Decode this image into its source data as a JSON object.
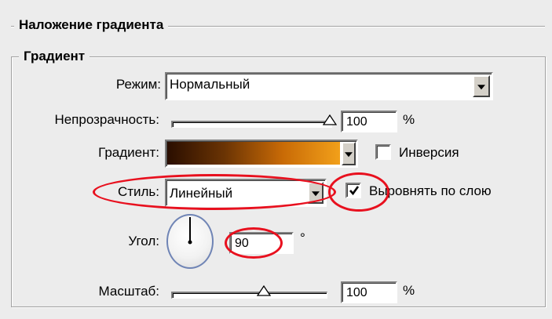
{
  "section_title": "Наложение градиента",
  "group_title": "Градиент",
  "mode": {
    "label": "Режим:",
    "value": "Нормальный"
  },
  "opacity": {
    "label": "Непрозрачность:",
    "value": "100",
    "unit": "%",
    "slider_fraction": 1.0
  },
  "gradient": {
    "label": "Градиент:",
    "colors": [
      "#2a0e00",
      "#6b3404",
      "#c86a06",
      "#f2a01a"
    ],
    "reverse_label": "Инверсия",
    "reverse_checked": false
  },
  "style": {
    "label": "Стиль:",
    "value": "Линейный",
    "align_label": "Выровнять по слою",
    "align_checked": true
  },
  "angle": {
    "label": "Угол:",
    "value": "90",
    "unit": "°"
  },
  "scale": {
    "label": "Масштаб:",
    "value": "100",
    "unit": "%",
    "slider_fraction": 0.6
  },
  "highlight_color": "#e8101e"
}
